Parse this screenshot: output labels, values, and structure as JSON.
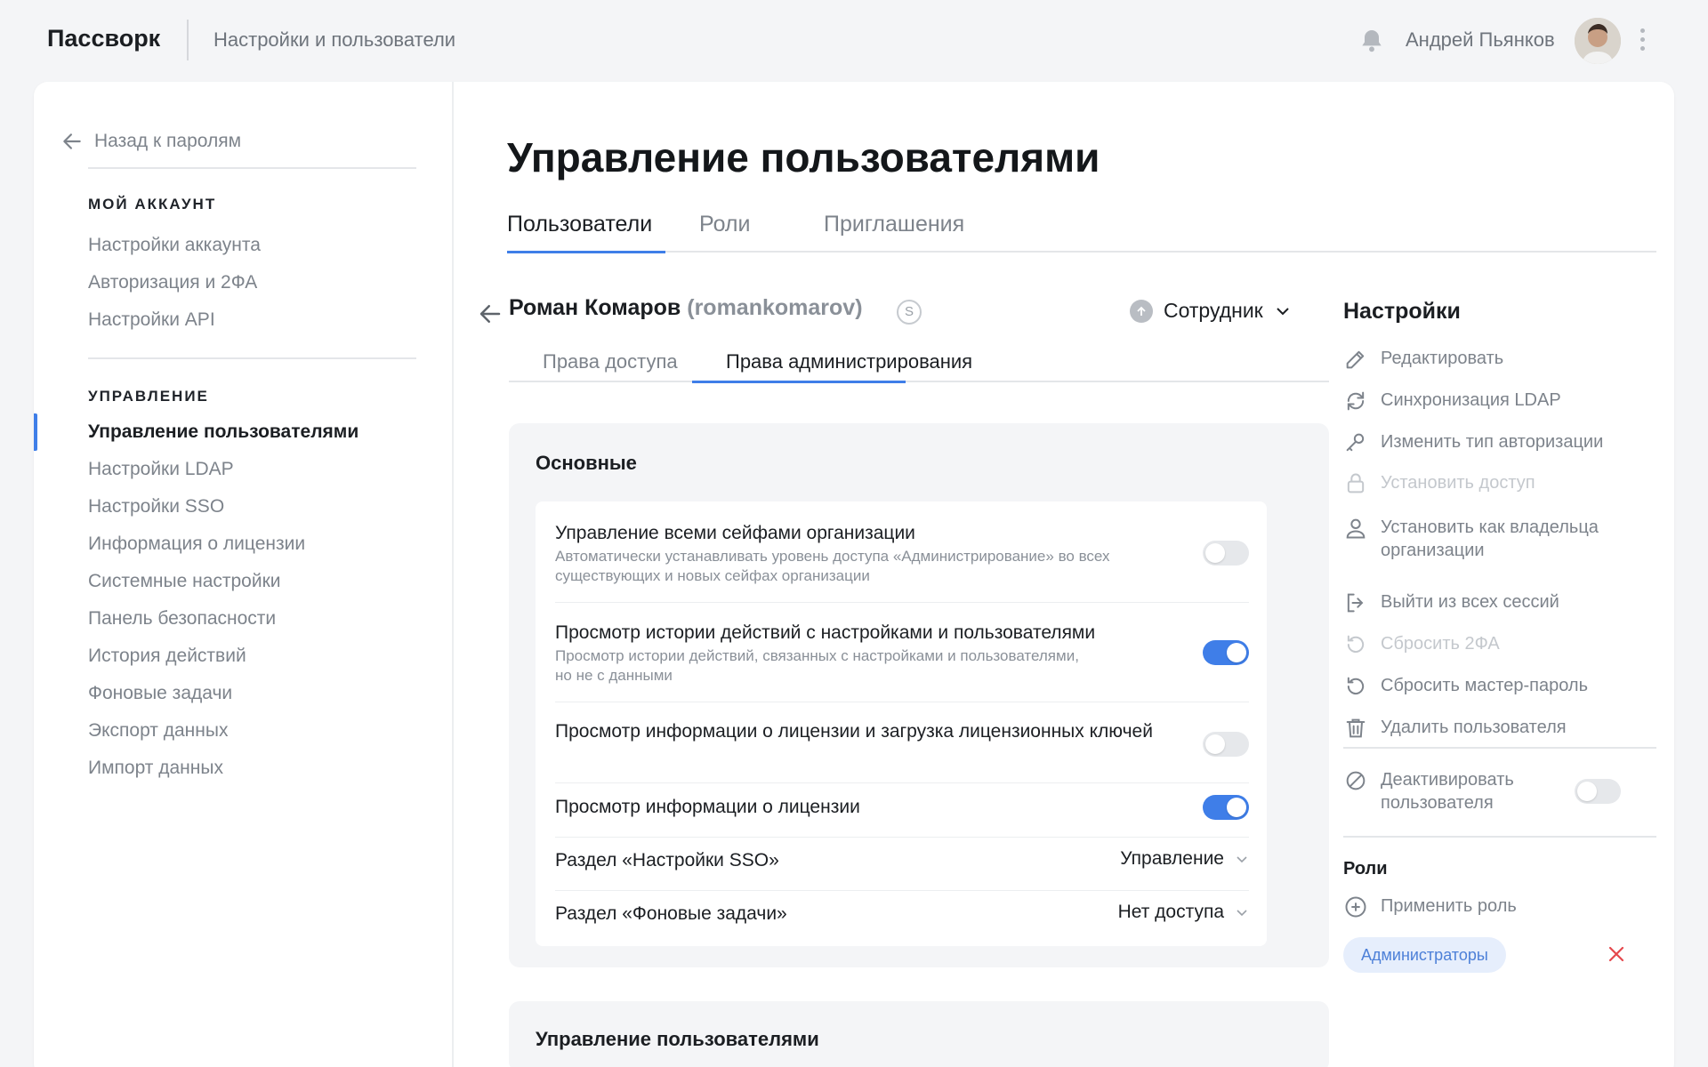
{
  "header": {
    "brand": "Пассворк",
    "breadcrumb": "Настройки и пользователи",
    "user_name": "Андрей Пьянков"
  },
  "sidebar": {
    "back_label": "Назад к паролям",
    "account_heading": "МОЙ АККАУНТ",
    "account_items": [
      "Настройки аккаунта",
      "Авторизация и 2ФА",
      "Настройки API"
    ],
    "admin_heading": "УПРАВЛЕНИЕ",
    "admin_items": [
      "Управление пользователями",
      "Настройки LDAP",
      "Настройки SSO",
      "Информация о лицензии",
      "Системные настройки",
      "Панель безопасности",
      "История действий",
      "Фоновые задачи",
      "Экспорт данных",
      "Импорт данных"
    ],
    "active_item": "Управление пользователями"
  },
  "main": {
    "title": "Управление пользователями",
    "tabs": [
      "Пользователи",
      "Роли",
      "Приглашения"
    ],
    "active_tab": "Пользователи",
    "user": {
      "name": "Роман Комаров",
      "login": "(romankomarov)",
      "badge": "S",
      "role": "Сотрудник"
    },
    "subtabs": [
      "Права доступа",
      "Права администрирования"
    ],
    "active_subtab": "Права администрирования",
    "section_title": "Основные",
    "permissions": [
      {
        "title": "Управление всеми сейфами организации",
        "desc": "Автоматически устанавливать уровень доступа «Администрирование» во всех существующих и новых сейфах организации",
        "enabled": false
      },
      {
        "title": "Просмотр истории действий с настройками и пользователями",
        "desc": "Просмотр истории действий, связанных с настройками и пользователями, но не с данными",
        "enabled": true
      },
      {
        "title": "Просмотр информации о лицензии и загрузка лицензионных ключей",
        "desc": "",
        "enabled": false
      },
      {
        "title": "Просмотр информации о лицензии",
        "desc": "",
        "enabled": true
      }
    ],
    "selects": [
      {
        "title": "Раздел «Настройки SSO»",
        "value": "Управление"
      },
      {
        "title": "Раздел «Фоновые задачи»",
        "value": "Нет доступа"
      }
    ],
    "section2_title": "Управление пользователями"
  },
  "settings": {
    "title": "Настройки",
    "actions": [
      {
        "label": "Редактировать",
        "icon": "edit-icon",
        "disabled": false
      },
      {
        "label": "Синхронизация LDAP",
        "icon": "sync-icon",
        "disabled": false
      },
      {
        "label": "Изменить тип авторизации",
        "icon": "key-icon",
        "disabled": false
      },
      {
        "label": "Установить доступ",
        "icon": "lock-icon",
        "disabled": true
      },
      {
        "label": "Установить как владельца организации",
        "icon": "user-icon",
        "disabled": false
      },
      {
        "label": "Выйти из всех сессий",
        "icon": "logout-icon",
        "disabled": false
      },
      {
        "label": "Сбросить 2ФА",
        "icon": "reset-icon",
        "disabled": true
      },
      {
        "label": "Сбросить мастер-пароль",
        "icon": "reset-icon",
        "disabled": false
      },
      {
        "label": "Удалить пользователя",
        "icon": "trash-icon",
        "disabled": false
      }
    ],
    "deactivate_label": "Деактивировать пользователя",
    "deactivate_enabled": false,
    "roles_heading": "Роли",
    "apply_role_label": "Применить роль",
    "roles": [
      "Администраторы"
    ]
  },
  "colors": {
    "accent": "#3f7ee8",
    "danger": "#e5484d"
  }
}
